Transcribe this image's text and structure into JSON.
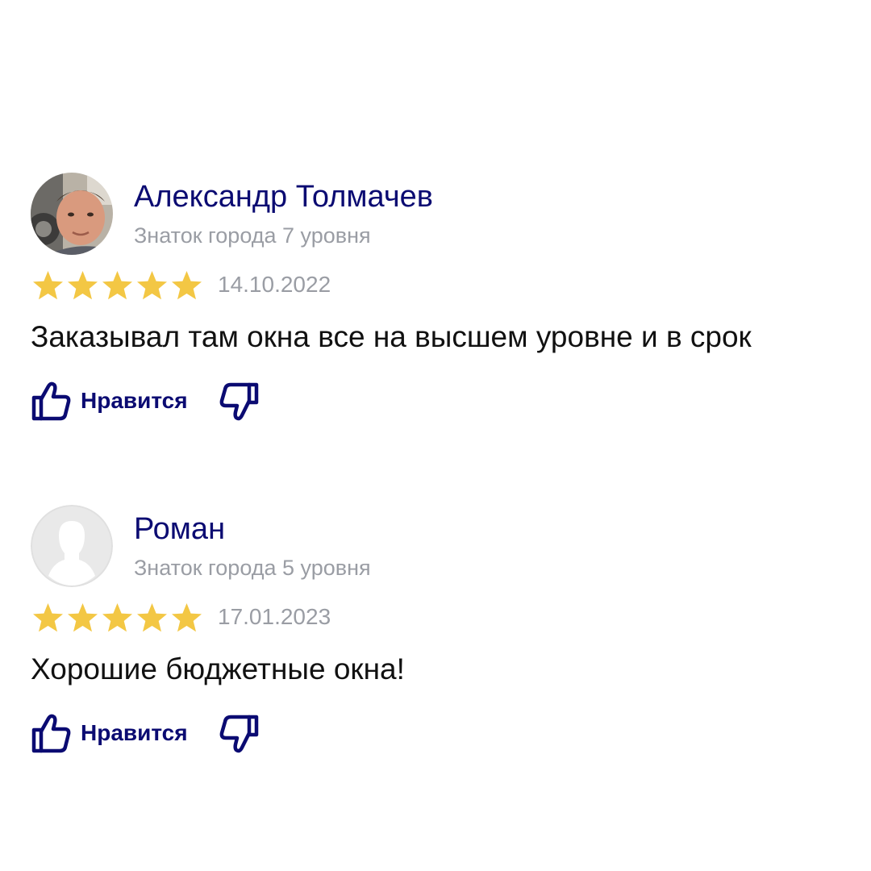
{
  "colors": {
    "author": "#0b0b72",
    "muted": "#9a9da4",
    "star": "#f3c744",
    "text": "#111111",
    "icon": "#0b0b72"
  },
  "reviews": [
    {
      "author": "Александр Толмачев",
      "level": "Знаток города 7 уровня",
      "rating": 5,
      "date": "14.10.2022",
      "text": "Заказывал там окна все на высшем уровне и в срок",
      "like_label": "Нравится",
      "avatar": "user-photo",
      "like_icon": "thumbs-up-icon",
      "dislike_icon": "thumbs-down-icon"
    },
    {
      "author": "Роман",
      "level": "Знаток города 5 уровня",
      "rating": 5,
      "date": "17.01.2023",
      "text": "Хорошие бюджетные окна!",
      "like_label": "Нравится",
      "avatar": "default-avatar-silhouette",
      "like_icon": "thumbs-up-icon",
      "dislike_icon": "thumbs-down-icon"
    }
  ]
}
